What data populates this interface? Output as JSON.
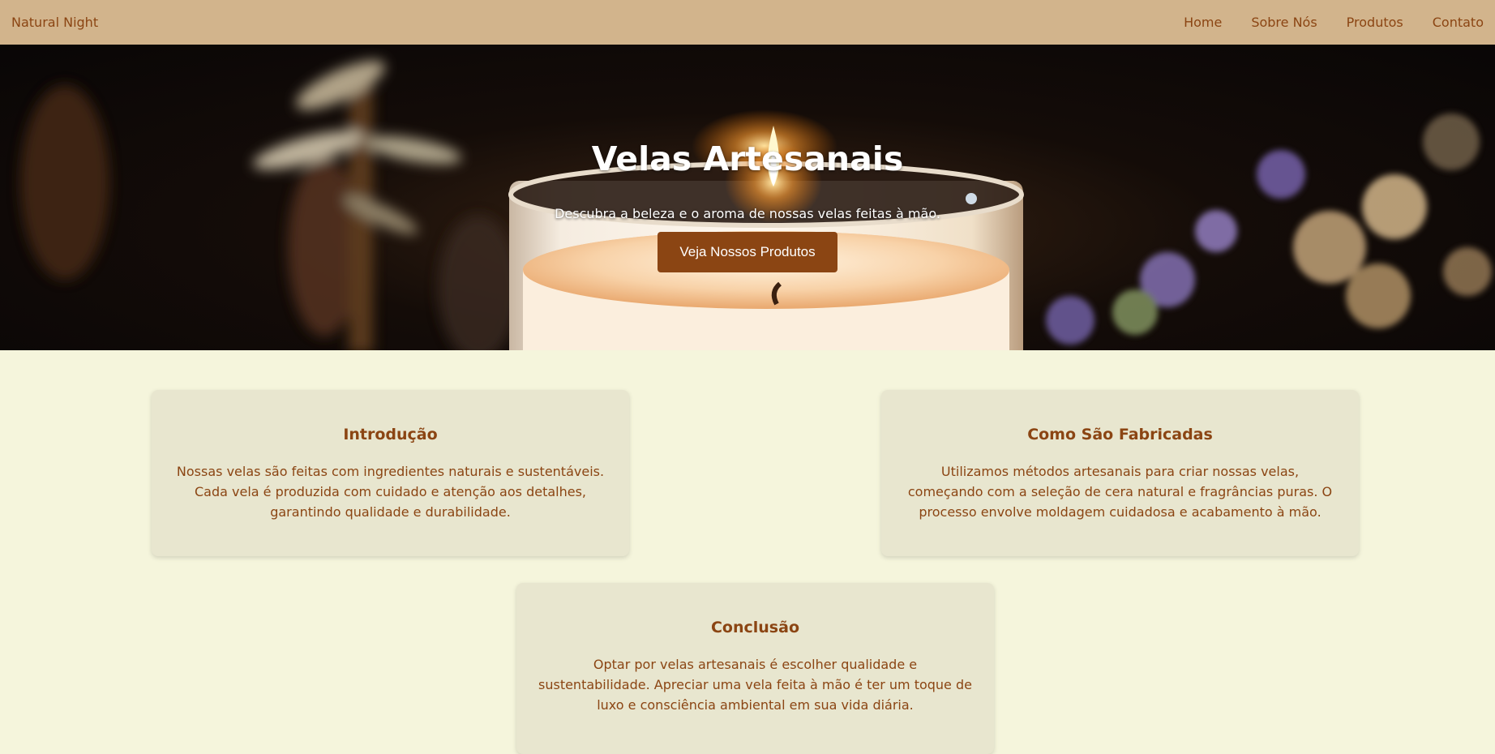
{
  "header": {
    "brand": "Natural Night",
    "nav": [
      "Home",
      "Sobre Nós",
      "Produtos",
      "Contato"
    ]
  },
  "hero": {
    "title": "Velas Artesanais",
    "subtitle": "Descubra a beleza e o aroma de nossas velas feitas à mão.",
    "button_label": "Veja Nossos Produtos",
    "image_description_icon": "candle-background"
  },
  "cards": [
    {
      "title": "Introdução",
      "text": "Nossas velas são feitas com ingredientes naturais e sustentáveis. Cada vela é produzida com cuidado e atenção aos detalhes, garantindo qualidade e durabilidade."
    },
    {
      "title": "Como São Fabricadas",
      "text": "Utilizamos métodos artesanais para criar nossas velas, começando com a seleção de cera natural e fragrâncias puras. O processo envolve moldagem cuidadosa e acabamento à mão."
    },
    {
      "title": "Conclusão",
      "text": "Optar por velas artesanais é escolher qualidade e sustentabilidade. Apreciar uma vela feita à mão é ter um toque de luxo e consciência ambiental em sua vida diária."
    }
  ],
  "colors": {
    "header_bg": "#d2b48c",
    "page_bg": "#f5f5dc",
    "card_bg": "#e8e6cf",
    "accent": "#8b4513",
    "hero_text": "#ffffff"
  }
}
